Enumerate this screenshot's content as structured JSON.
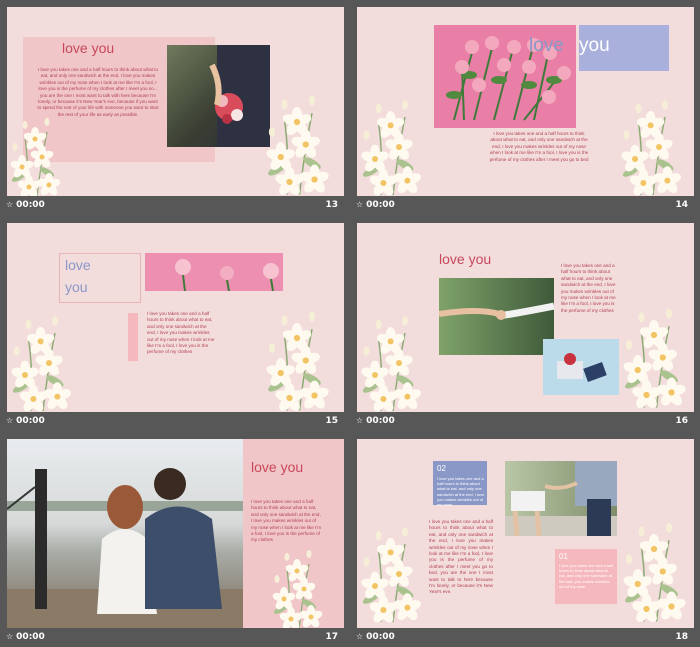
{
  "slides": [
    {
      "num": "13",
      "time": "00:00",
      "title": "love you",
      "body": "I love you takes one and a half hours to think about what to eat, and only one sandwich at the end, I love you makes wrinkles out of my nose when I look at me like I'm a fool, I love you is the perfume of my clothes after I meet you so... you are the one I most want to talk with here because I'm lonely, or because it's New Year's eve, because if you want to spend the rest of your life with someone you want to start the rest of your life as early as possible."
    },
    {
      "num": "14",
      "time": "00:00",
      "title_a": "love",
      "title_b": "you",
      "body": "I love you takes one and a half hours to think about what to eat, and only one sandwich at the end, I love you makes wrinkles out of my nose when I look at me like I'm a fool, I love you is the perfume of my clothes after I meet you go to bed"
    },
    {
      "num": "15",
      "time": "00:00",
      "title_a": "love",
      "title_b": "you",
      "body": "I love you takes one and a half hours to think about what to eat, and only one sandwich at the end, I love you makes wrinkles out of my nose when I look at me like I'm a fool, I love you is the perfume of my clothes"
    },
    {
      "num": "16",
      "time": "00:00",
      "title": "love you",
      "body": "I love you takes one and a half hours to think about what to eat, and only one sandwich at the end, I love you makes wrinkles out of my nose when I look at me like I'm a fool, I love you is the perfume of my clothes"
    },
    {
      "num": "17",
      "time": "00:00",
      "title": "love you",
      "body": "I love you takes one and a half hours to think about what to eat, and only one sandwich at the end, I love you makes wrinkles out of my nose when I look at me like I'm a fool, I love you is the perfume of my clothes"
    },
    {
      "num": "18",
      "time": "00:00",
      "badge_a": "02",
      "badge_b": "01",
      "body_a": "I love you takes one and a half hours to think about what to eat, and only one sandwich at the end, I love you makes wrinkles out of my nose",
      "body_main": "I love you takes one and a half hours to think about what to eat, and only one sandwich at the end, I love you makes wrinkles out of my nose when I look at me like I'm a fool, I love you is the perfume of my clothes after I meet you go to bed, you are the one I most want to talk to here because I'm lonely, or because it's New Year's eve.",
      "body_b": "I love you takes one and a half hours to think about what to eat, and only one sandwich at the end, you makes wrinkles out of my nose"
    }
  ],
  "colors": {
    "slide_bg": "#f3dcdc",
    "accent_red": "#c9485b",
    "accent_blue": "#8a98c8",
    "panel_pink": "#f0c6c8",
    "background": "#575757"
  }
}
